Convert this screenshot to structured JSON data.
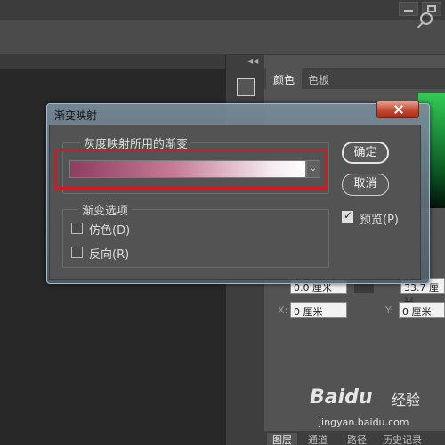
{
  "optionsbar": {
    "search_icon": "search-icon"
  },
  "panel": {
    "tabs": [
      {
        "label": "颜色",
        "active": true
      },
      {
        "label": "色板",
        "active": false
      }
    ],
    "fields": {
      "row1_left": "0.0 厘米",
      "row1_right": "33.7 厘米",
      "x_label": "X:",
      "x_value": "0 厘米",
      "y_label": "Y:",
      "y_value": "0 厘米"
    },
    "bottom_tabs": [
      {
        "label": "图层",
        "active": true
      },
      {
        "label": "通道",
        "active": false
      },
      {
        "label": "路径",
        "active": false
      },
      {
        "label": "历史记录",
        "active": false
      }
    ],
    "color_field_hex": "#1e8f3a"
  },
  "dialog": {
    "title": "渐变映射",
    "gradient_group_label": "灰度映射所用的渐变",
    "gradient": {
      "start": "#8e3c5f",
      "end": "#ffffff"
    },
    "options_group_label": "渐变选项",
    "dither_label": "仿色(D)",
    "dither_checked": false,
    "reverse_label": "反向(R)",
    "reverse_checked": false,
    "ok_label": "确定",
    "cancel_label": "取消",
    "preview_label": "预览(P)",
    "preview_checked": true,
    "highlight_color": "#e0141e"
  },
  "watermark": {
    "brand": "Baidu",
    "brand_cn": "经验",
    "url": "jingyan.baidu.com"
  }
}
